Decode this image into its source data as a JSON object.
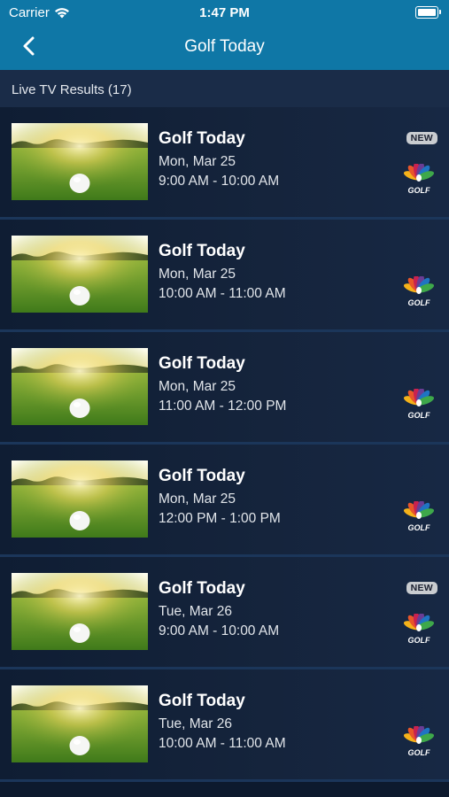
{
  "status": {
    "carrier": "Carrier",
    "time": "1:47 PM"
  },
  "nav": {
    "title": "Golf Today"
  },
  "results": {
    "label": "Live TV Results (17)"
  },
  "colors": {
    "header": "#0f77a6",
    "background": "#0d1a2e",
    "badge": "#c9ccd0"
  },
  "items": [
    {
      "title": "Golf Today",
      "date": "Mon, Mar 25",
      "time": "9:00 AM - 10:00 AM",
      "badge": "NEW",
      "network": "GOLF"
    },
    {
      "title": "Golf Today",
      "date": "Mon, Mar 25",
      "time": "10:00 AM - 11:00 AM",
      "badge": "",
      "network": "GOLF"
    },
    {
      "title": "Golf Today",
      "date": "Mon, Mar 25",
      "time": "11:00 AM - 12:00 PM",
      "badge": "",
      "network": "GOLF"
    },
    {
      "title": "Golf Today",
      "date": "Mon, Mar 25",
      "time": "12:00 PM - 1:00 PM",
      "badge": "",
      "network": "GOLF"
    },
    {
      "title": "Golf Today",
      "date": "Tue, Mar 26",
      "time": "9:00 AM - 10:00 AM",
      "badge": "NEW",
      "network": "GOLF"
    },
    {
      "title": "Golf Today",
      "date": "Tue, Mar 26",
      "time": "10:00 AM - 11:00 AM",
      "badge": "",
      "network": "GOLF"
    }
  ]
}
